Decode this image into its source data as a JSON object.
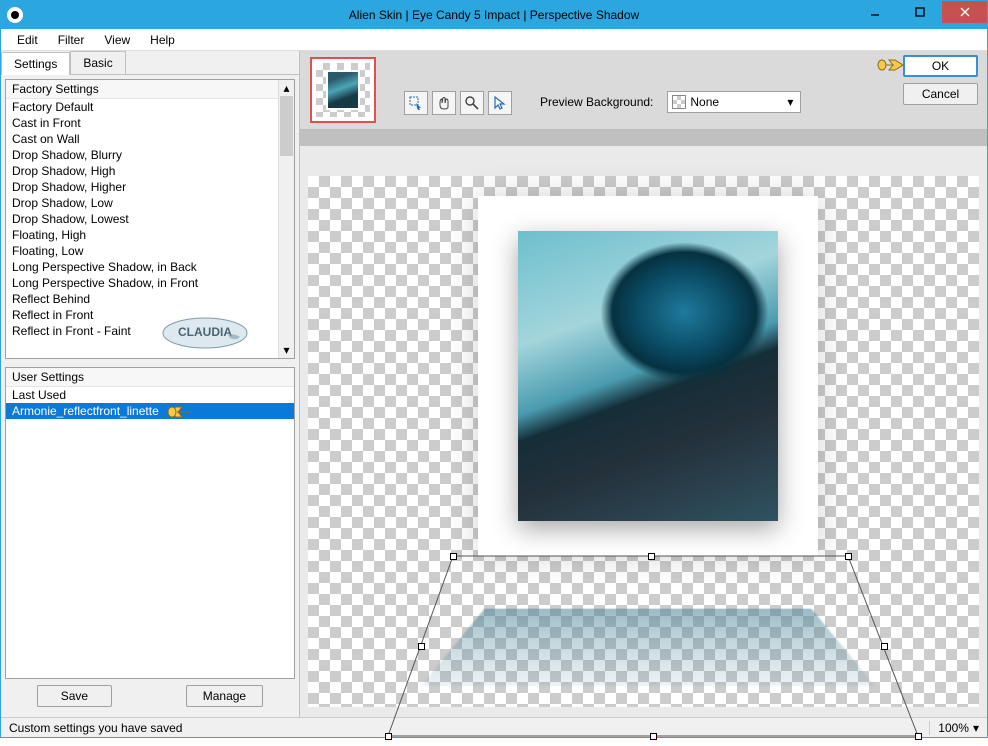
{
  "window": {
    "title": "Alien Skin | Eye Candy 5 Impact | Perspective Shadow"
  },
  "menu": {
    "edit": "Edit",
    "filter": "Filter",
    "view": "View",
    "help": "Help"
  },
  "tabs": {
    "settings": "Settings",
    "basic": "Basic"
  },
  "factory": {
    "header": "Factory Settings",
    "items": [
      "Factory Default",
      "Cast in Front",
      "Cast on Wall",
      "Drop Shadow, Blurry",
      "Drop Shadow, High",
      "Drop Shadow, Higher",
      "Drop Shadow, Low",
      "Drop Shadow, Lowest",
      "Floating, High",
      "Floating, Low",
      "Long Perspective Shadow, in Back",
      "Long Perspective Shadow, in Front",
      "Reflect Behind",
      "Reflect in Front",
      "Reflect in Front - Faint"
    ]
  },
  "user": {
    "header": "User Settings",
    "last_used": "Last Used",
    "selected": "Armonie_reflectfront_linette"
  },
  "buttons": {
    "save": "Save",
    "manage": "Manage",
    "ok": "OK",
    "cancel": "Cancel"
  },
  "preview": {
    "bg_label": "Preview Background:",
    "bg_value": "None"
  },
  "status": {
    "message": "Custom settings you have saved",
    "zoom": "100%"
  },
  "watermark": "CLAUDIA"
}
